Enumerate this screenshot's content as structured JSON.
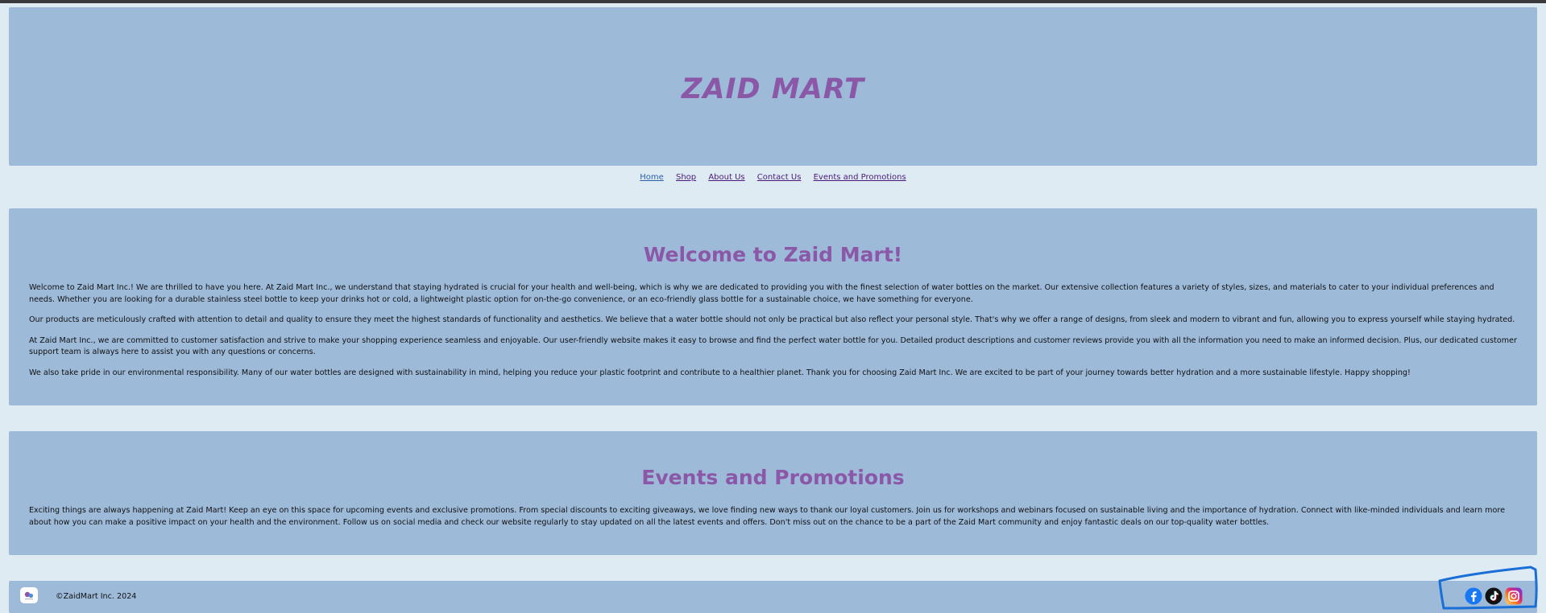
{
  "site": {
    "title": "ZAID MART"
  },
  "nav": {
    "items": [
      {
        "label": "Home"
      },
      {
        "label": "Shop"
      },
      {
        "label": "About Us"
      },
      {
        "label": "Contact Us"
      },
      {
        "label": "Events and Promotions"
      }
    ]
  },
  "welcome": {
    "heading": "Welcome to Zaid Mart!",
    "paragraphs": [
      "Welcome to Zaid Mart Inc.! We are thrilled to have you here. At Zaid Mart Inc., we understand that staying hydrated is crucial for your health and well-being, which is why we are dedicated to providing you with the finest selection of water bottles on the market. Our extensive collection features a variety of styles, sizes, and materials to cater to your individual preferences and needs. Whether you are looking for a durable stainless steel bottle to keep your drinks hot or cold, a lightweight plastic option for on-the-go convenience, or an eco-friendly glass bottle for a sustainable choice, we have something for everyone.",
      "Our products are meticulously crafted with attention to detail and quality to ensure they meet the highest standards of functionality and aesthetics. We believe that a water bottle should not only be practical but also reflect your personal style. That's why we offer a range of designs, from sleek and modern to vibrant and fun, allowing you to express yourself while staying hydrated.",
      "At Zaid Mart Inc., we are committed to customer satisfaction and strive to make your shopping experience seamless and enjoyable. Our user-friendly website makes it easy to browse and find the perfect water bottle for you. Detailed product descriptions and customer reviews provide you with all the information you need to make an informed decision. Plus, our dedicated customer support team is always here to assist you with any questions or concerns.",
      "We also take pride in our environmental responsibility. Many of our water bottles are designed with sustainability in mind, helping you reduce your plastic footprint and contribute to a healthier planet. Thank you for choosing Zaid Mart Inc. We are excited to be part of your journey towards better hydration and a more sustainable lifestyle. Happy shopping!"
    ]
  },
  "events": {
    "heading": "Events and Promotions",
    "paragraphs": [
      "Exciting things are always happening at Zaid Mart! Keep an eye on this space for upcoming events and exclusive promotions. From special discounts to exciting giveaways, we love finding new ways to thank our loyal customers. Join us for workshops and webinars focused on sustainable living and the importance of hydration. Connect with like-minded individuals and learn more about how you can make a positive impact on your health and the environment. Follow us on social media and check our website regularly to stay updated on all the latest events and offers. Don't miss out on the chance to be a part of the Zaid Mart community and enjoy fantastic deals on our top-quality water bottles."
    ]
  },
  "footer": {
    "copyright": "©ZaidMart Inc. 2024",
    "social": [
      "facebook-icon",
      "tiktok-icon",
      "instagram-icon"
    ]
  },
  "colors": {
    "page_bg": "#deebf3",
    "panel_bg": "#9dbad9",
    "heading": "#8b58a8",
    "nav_link": "#4a1a7a",
    "nav_active": "#2a5fa8",
    "highlight_annotation": "#1a6fd6"
  }
}
